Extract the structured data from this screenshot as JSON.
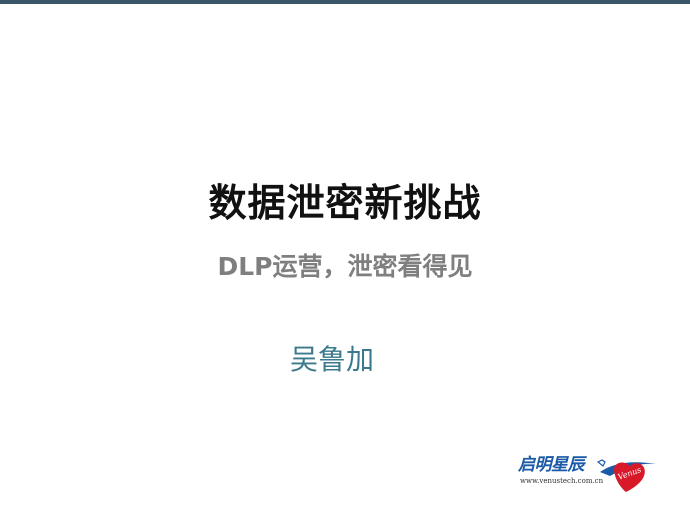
{
  "slide": {
    "title": "数据泄密新挑战",
    "subtitle": "DLP运营，泄密看得见",
    "presenter": "吴鲁加"
  },
  "logo": {
    "name": "启明星辰",
    "url": "www.venustech.com.cn",
    "mark_text": "Venus"
  },
  "colors": {
    "top_bar": "#3b5568",
    "title": "#111111",
    "subtitle": "#7f7f7f",
    "presenter": "#3b7a8c",
    "logo_blue": "#1b5aa6",
    "logo_red": "#d7192a"
  }
}
